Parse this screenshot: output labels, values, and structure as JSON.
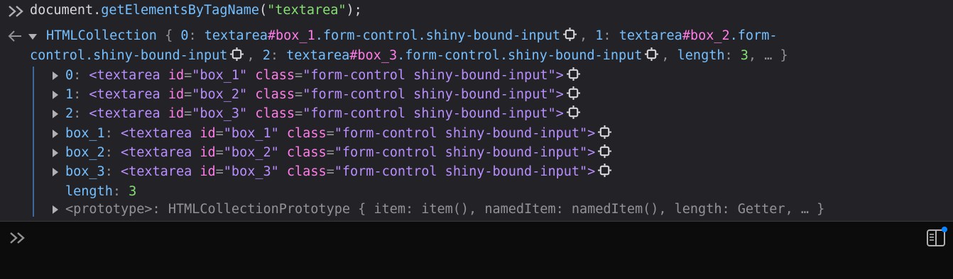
{
  "input": {
    "object": "document",
    "method": "getElementsByTagName",
    "arg": "\"textarea\""
  },
  "result": {
    "type": "HTMLCollection",
    "summary": [
      {
        "key": "0",
        "tag": "textarea",
        "sel_id": "#box_1",
        "sel_class": ".form-control.shiny-bound-input"
      },
      {
        "key": "1",
        "tag": "textarea",
        "sel_id": "#box_2",
        "sel_class_a": ".form-",
        "sel_class_b": "control.shiny-bound-input"
      },
      {
        "key": "2",
        "tag": "textarea",
        "sel_id": "#box_3",
        "sel_class": ".form-control.shiny-bound-input"
      }
    ],
    "length_label": "length",
    "length_value": "3",
    "ellipsis": "… }",
    "items": [
      {
        "key": "0",
        "id": "\"box_1\"",
        "class": "\"form-control shiny-bound-input\""
      },
      {
        "key": "1",
        "id": "\"box_2\"",
        "class": "\"form-control shiny-bound-input\""
      },
      {
        "key": "2",
        "id": "\"box_3\"",
        "class": "\"form-control shiny-bound-input\""
      },
      {
        "key": "box_1",
        "id": "\"box_1\"",
        "class": "\"form-control shiny-bound-input\""
      },
      {
        "key": "box_2",
        "id": "\"box_2\"",
        "class": "\"form-control shiny-bound-input\""
      },
      {
        "key": "box_3",
        "id": "\"box_3\"",
        "class": "\"form-control shiny-bound-input\""
      }
    ],
    "length_row": {
      "key": "length",
      "value": "3"
    },
    "prototype": {
      "key": "<prototype>",
      "value": "HTMLCollectionPrototype { item: item(), namedItem: namedItem(), length: Getter, … }"
    }
  },
  "icons": {
    "prompt": "double-chevron-icon",
    "result": "left-arrow-icon",
    "node": "target-node-icon",
    "sidebar": "sidebar-toggle-icon"
  }
}
